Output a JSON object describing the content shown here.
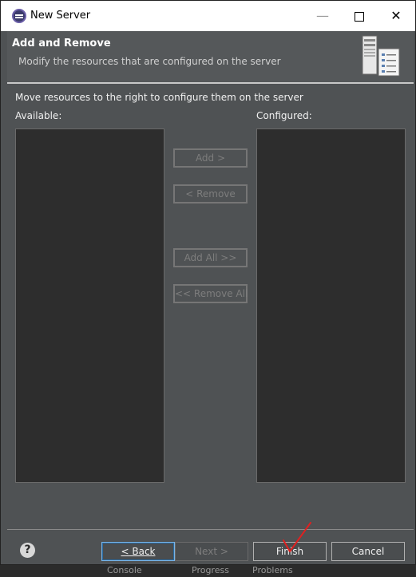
{
  "window": {
    "title": "New Server",
    "controls": {
      "minimize": "—",
      "close": "✕"
    }
  },
  "header": {
    "title": "Add and Remove",
    "description": "Modify the resources that are configured on the server"
  },
  "body": {
    "instruction": "Move resources to the right to configure them on the server",
    "available_label": "Available:",
    "configured_label": "Configured:",
    "available_items": [],
    "configured_items": []
  },
  "buttons": {
    "add": "Add >",
    "remove": "< Remove",
    "add_all": "Add All >>",
    "remove_all": "<< Remove All"
  },
  "footer": {
    "help": "?",
    "back": "< Back",
    "next": "Next >",
    "finish": "Finish",
    "cancel": "Cancel"
  },
  "taskbar": {
    "items": [
      "Console",
      "Progress",
      "Problems"
    ]
  },
  "colors": {
    "dialog_bg": "#4f5254",
    "list_bg": "#2d2d2d",
    "annotation": "#e02020"
  }
}
